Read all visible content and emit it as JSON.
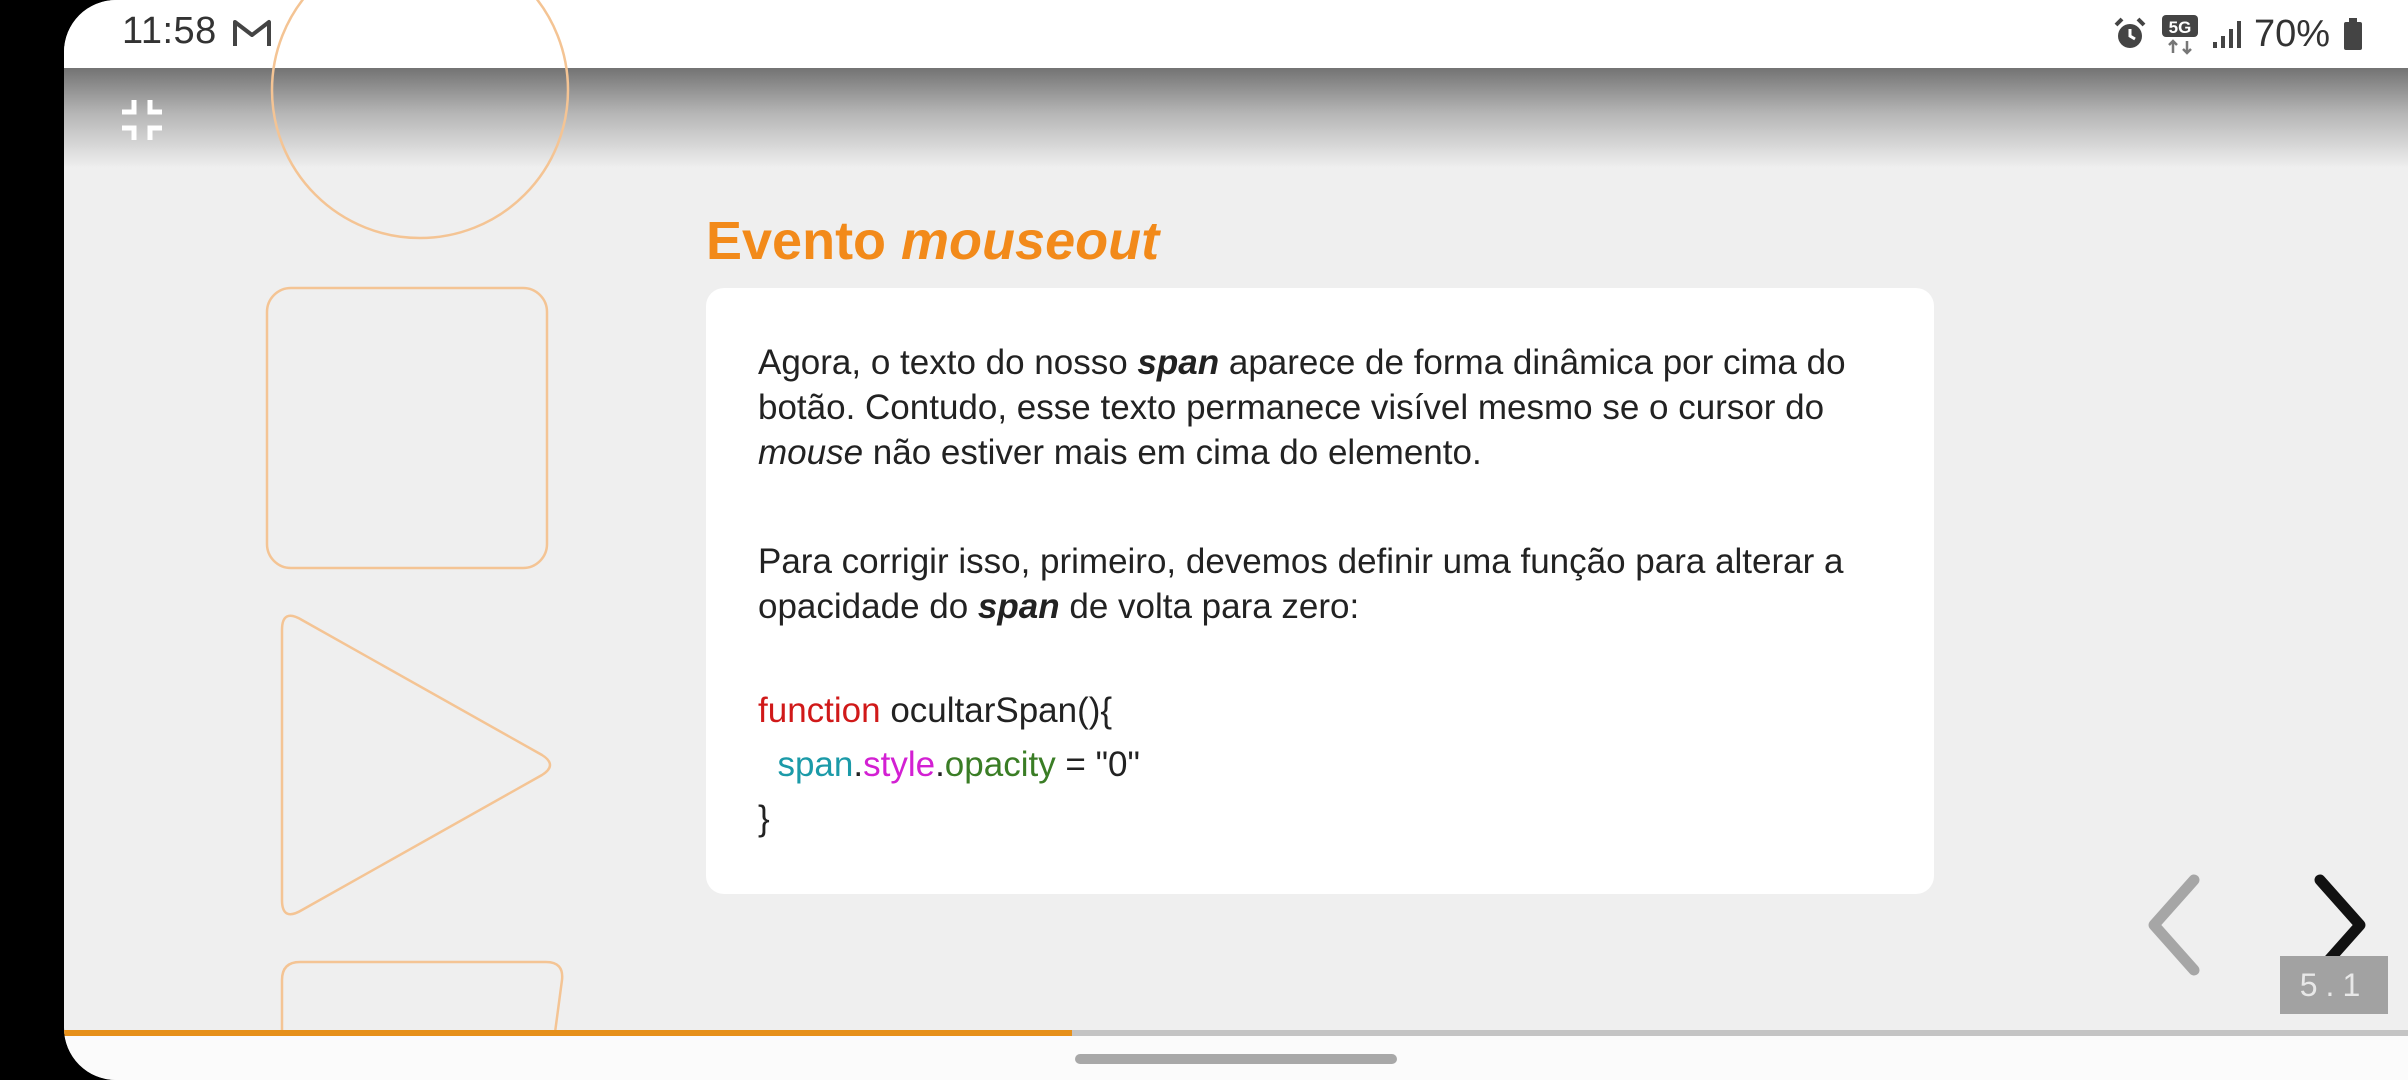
{
  "status_bar": {
    "time": "11:58",
    "network": "5G",
    "battery": "70%"
  },
  "slide": {
    "title_plain": "Evento ",
    "title_italic": "mouseout",
    "paragraph1": {
      "a": "Agora, o texto do nosso ",
      "b": "span",
      "c": " aparece de forma dinâmica por cima do botão. Contudo, esse texto permanece visível mesmo se o cursor do ",
      "d": "mouse",
      "e": " não estiver mais em cima do elemento."
    },
    "paragraph2": {
      "a": "Para corrigir isso, primeiro, devemos definir uma função para alterar a opacidade do ",
      "b": "span",
      "c": " de volta para zero:"
    },
    "code": {
      "keyword": "function",
      "signature": " ocultarSpan(){",
      "indent": "  ",
      "obj": "span",
      "dot1": ".",
      "prop1": "style",
      "dot2": ".",
      "prop2": "opacity",
      "assign": " = \"0\"",
      "close": "}"
    },
    "slide_number": "5.1",
    "progress": 0.43
  },
  "colors": {
    "accent": "#f28a1a",
    "code_keyword": "#d01919",
    "code_object": "#1b9aa8",
    "code_property1": "#d320d3",
    "code_property2": "#3a7d25",
    "progress": "#e6901a"
  },
  "icons": [
    "gmail-icon",
    "alarm-icon",
    "network-5g-icon",
    "signal-icon",
    "battery-icon",
    "exit-fullscreen-icon",
    "chevron-left-icon",
    "chevron-right-icon"
  ]
}
